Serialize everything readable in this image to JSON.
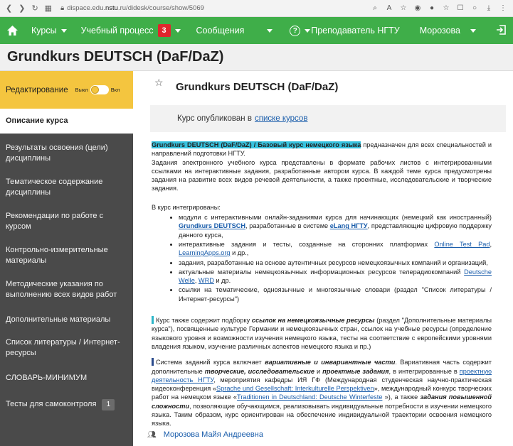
{
  "browser": {
    "url_prefix": "dispace.edu.",
    "url_domain": "nstu",
    "url_suffix": ".ru/didesk/course/show/5069"
  },
  "navbar": {
    "courses": "Курсы",
    "process": "Учебный процесс",
    "process_badge": "3",
    "messages": "Сообщения",
    "help": "?",
    "role": "Преподаватель НГТУ",
    "user": "Морозова"
  },
  "course": {
    "title": "Grundkurs DEUTSCH (DaF/DaZ)"
  },
  "sidebar": {
    "edit_label": "Редактирование",
    "toggle_off": "Выкл",
    "toggle_on": "Вкл",
    "items": [
      {
        "label": "Описание курса"
      },
      {
        "label": "Результаты освоения (цели) дисциплины"
      },
      {
        "label": "Тематическое содержание дисциплины"
      },
      {
        "label": "Рекомендации по работе с курсом"
      },
      {
        "label": "Контрольно-измерительные материалы"
      },
      {
        "label": "Методические указания по выполнению всех видов работ"
      },
      {
        "label": "Дополнительные материалы"
      },
      {
        "label": "Список литературы / Интернет-ресурсы"
      },
      {
        "label": "СЛОВАРЬ-МИНИМУМ"
      },
      {
        "label": "Тесты для самоконтроля",
        "count": "1"
      }
    ]
  },
  "main": {
    "title": "Grundkurs DEUTSCH (DaF/DaZ)",
    "published_text": "Курс опубликован в",
    "published_link": "списке курсов",
    "intro_title": "Grundkurs DEUTSCH (DaF/DaZ) / Базовый курс немецкого языка",
    "intro_rest": " предназначен для всех специальностей и направлений подготовки НГТУ.",
    "para2": "Задания электронного учебного курса представлены в формате рабочих листов с интегрированными ссылками на интерактивные задания, разработанные автором курса. В каждой теме курса предусмотрены задания на развитие всех видов речевой деятельности, а также проектные, исследовательские и творческие задания.",
    "integrated_heading": "В курс интегрированы:",
    "li1_a": "модули с интерактивными онлайн-заданиями курса для начинающих (немецкий как иностранный) ",
    "li1_link1": "Grundkurs DEUTSCH",
    "li1_b": ", разработанные в системе ",
    "li1_link2": "eLang НГТУ",
    "li1_c": ", представляющие цифровую поддержку данного курса,",
    "li2_a": "интерактивные задания и тесты, созданные на сторонних платформах ",
    "li2_link1": "Online Test Pad",
    "li2_b": ", ",
    "li2_link2": "LearningApps.org",
    "li2_c": " и др.,",
    "li3": "задания, разработанные на основе аутентичных ресурсов немецкоязычных компаний и организаций,",
    "li4_a": "актуальные материалы немецкоязычных информационных ресурсов телерадиокомпаний ",
    "li4_link1": "Deutsche Welle",
    "li4_b": ", ",
    "li4_link2": "WRD",
    "li4_c": " и др.",
    "li5": "ссылки на тематические, одноязычные и многоязычные словари (раздел \"Список литературы / Интернет-ресурсы\")",
    "para3_a": "Курс также содержит подборку ",
    "para3_b": "ссылок на немецкоязычные ресурсы",
    "para3_c": " (раздел \"Дополнительные материалы курса\"), посвященные культуре Германии и немецкоязычных стран, ссылок на учебные ресурсы (определение языкового уровня и возможности изучения немецкого языка, тесты на соответствие с европейскими уровнями владения языком, изучение различных аспектов немецкого языка и пр.)",
    "para4_a": "Система заданий курса включает ",
    "para4_b": "вариативные и инвариантные части",
    "para4_c": ". Вариативная часть содержит дополнительные ",
    "para4_d": "творческие, исследовательские",
    "para4_e": " и ",
    "para4_f": "проектные задания",
    "para4_g": ", в интегрированные в ",
    "para4_link1": "проектную деятельность НГТУ",
    "para4_h": ", мероприятия кафедры ИЯ ГФ (Международная студенческая научно-практическая видеоконференция «",
    "para4_link2": "Sprache und Gesellschaft: Interkulturelle Perspektiven",
    "para4_i": "», международный конкурс творческих работ на немецком языке «",
    "para4_link3": "Traditionen in Deutschland: Deutsche Winterfeste",
    "para4_j": " »), а также ",
    "para4_k": "задания повышенной сложности",
    "para4_l": ", позволяющие обучающимся, реализовывать индивидуальные потребности в изучении немецкого языка. Таким образом, курс ориентирован на обеспечение индивидуальной траектории освоения немецкого языка.",
    "teacher": "Морозова Майя Андреевна"
  }
}
